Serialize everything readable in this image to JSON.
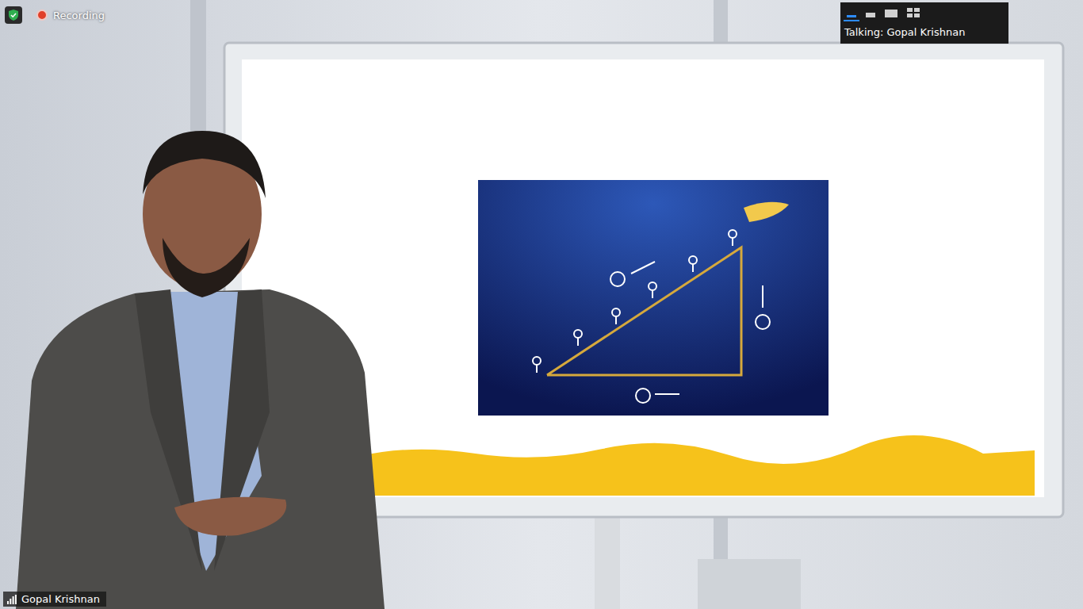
{
  "security": {
    "encrypted": true
  },
  "recording": {
    "label": "Recording",
    "on": true
  },
  "view_buttons": [
    {
      "kind": "minimize",
      "selected": true
    },
    {
      "kind": "strip",
      "selected": false
    },
    {
      "kind": "speaker",
      "selected": false
    },
    {
      "kind": "gallery",
      "selected": false
    }
  ],
  "speaker_indicator": {
    "text": "Talking: Gopal Krishnan"
  },
  "participant": {
    "name": "Gopal Krishnan"
  }
}
